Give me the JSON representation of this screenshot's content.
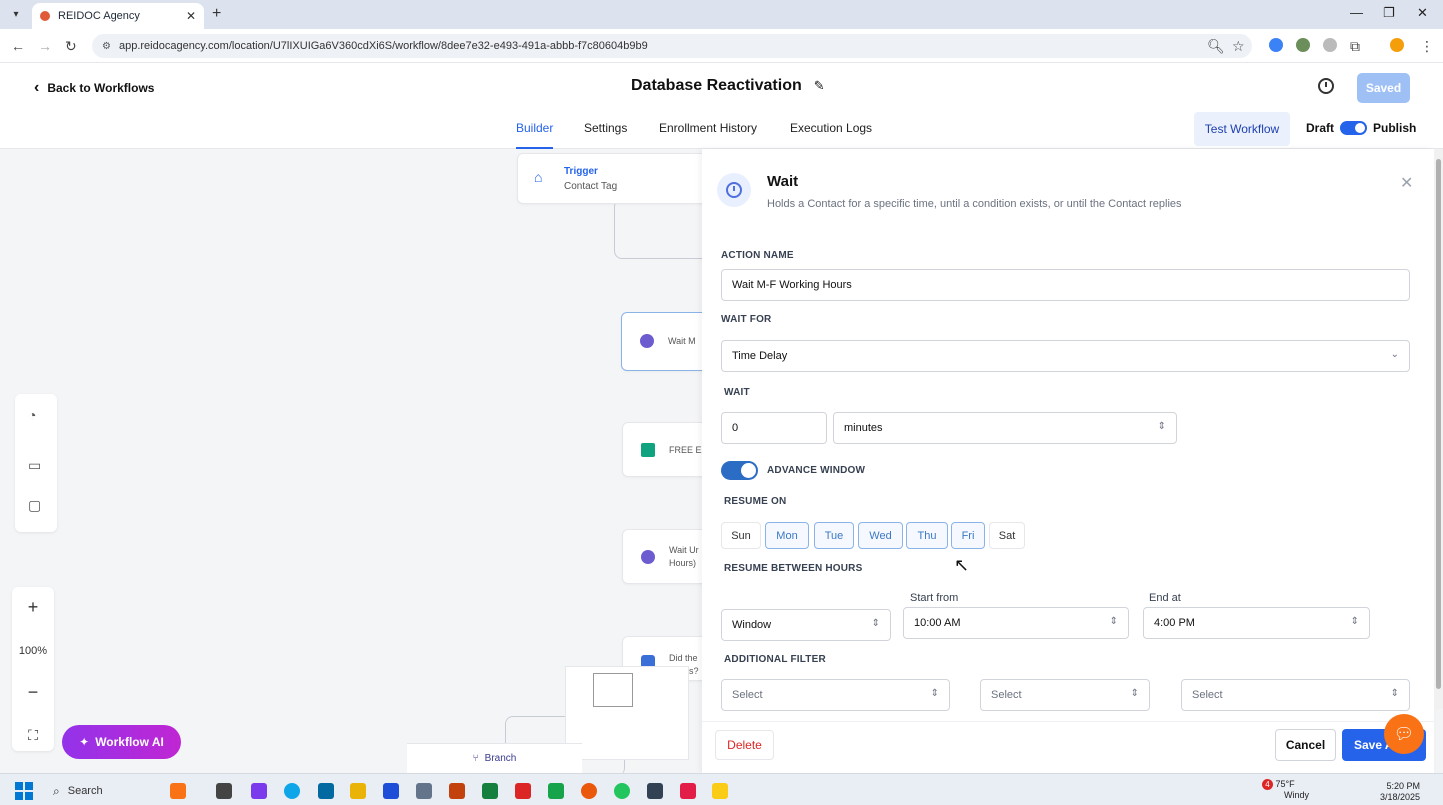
{
  "browser": {
    "tab_title": "REIDOC Agency",
    "url": "app.reidocagency.com/location/U7lIXUIGa6V360cdXi6S/workflow/8dee7e32-e493-491a-abbb-f7c80604b9b9"
  },
  "header": {
    "back_label": "Back to Workflows",
    "workflow_title": "Database Reactivation",
    "saved_label": "Saved",
    "tabs": [
      {
        "label": "Builder"
      },
      {
        "label": "Settings"
      },
      {
        "label": "Enrollment History"
      },
      {
        "label": "Execution Logs"
      }
    ],
    "test_workflow_label": "Test Workflow",
    "draft_label": "Draft",
    "publish_label": "Publish"
  },
  "canvas": {
    "trigger_title": "Trigger",
    "trigger_sub": "Contact Tag",
    "node_wait1": "Wait M",
    "node_free": "FREE Eb",
    "node_wait2_a": "Wait Ur",
    "node_wait2_b": "Hours)",
    "node_did_a": "Did the",
    "node_did_b": "s?",
    "zoom_level": "100%",
    "workflow_ai_label": "Workflow AI",
    "branch_label": "Branch"
  },
  "panel": {
    "title": "Wait",
    "subtitle": "Holds a Contact for a specific time, until a condition exists, or until the Contact replies",
    "action_name_label": "ACTION NAME",
    "action_name_value": "Wait M-F Working Hours",
    "wait_for_label": "WAIT FOR",
    "wait_for_value": "Time Delay",
    "wait_label": "WAIT",
    "wait_amount": "0",
    "wait_unit": "minutes",
    "advance_window_label": "ADVANCE WINDOW",
    "resume_on_label": "RESUME ON",
    "days": [
      {
        "label": "Sun",
        "selected": false
      },
      {
        "label": "Mon",
        "selected": true
      },
      {
        "label": "Tue",
        "selected": true
      },
      {
        "label": "Wed",
        "selected": true
      },
      {
        "label": "Thu",
        "selected": true
      },
      {
        "label": "Fri",
        "selected": true
      },
      {
        "label": "Sat",
        "selected": false
      }
    ],
    "resume_between_label": "RESUME BETWEEN HOURS",
    "window_value": "Window",
    "start_from_label": "Start from",
    "start_from_value": "10:00 AM",
    "end_at_label": "End at",
    "end_at_value": "4:00 PM",
    "additional_filter_label": "ADDITIONAL FILTER",
    "filter_placeholder_1": "Select",
    "filter_placeholder_2": "Select",
    "filter_placeholder_3": "Select",
    "delete_label": "Delete",
    "cancel_label": "Cancel",
    "save_label": "Save A"
  },
  "taskbar": {
    "search_label": "Search",
    "weather_temp": "75°F",
    "weather_desc": "Windy",
    "weather_badge": "4",
    "time": "5:20 PM",
    "date": "3/18/2025"
  },
  "colors": {
    "accent": "#2563eb",
    "saved_button": "#9ec0f5",
    "danger": "#dc2626",
    "ai_gradient_start": "#9333ea",
    "ai_gradient_end": "#c026d3"
  }
}
